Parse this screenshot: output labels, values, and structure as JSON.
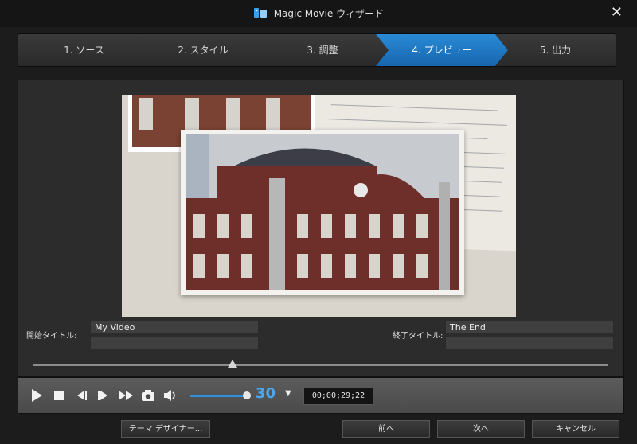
{
  "window": {
    "title": "Magic Movie ウィザード",
    "close_icon": "close-icon"
  },
  "steps": [
    {
      "label": "1. ソース",
      "active": false
    },
    {
      "label": "2. スタイル",
      "active": false
    },
    {
      "label": "3. 調整",
      "active": false
    },
    {
      "label": "4. プレビュー",
      "active": true
    },
    {
      "label": "5. 出力",
      "active": false
    }
  ],
  "titles": {
    "start_label": "開始タイトル:",
    "start_value": "My Video",
    "end_label": "終了タイトル:",
    "end_value": "The End"
  },
  "player": {
    "fps": "30",
    "timecode": "00;00;29;22",
    "icons": [
      "play-icon",
      "stop-icon",
      "prev-frame-icon",
      "next-frame-icon",
      "fast-forward-icon",
      "camera-icon",
      "volume-icon"
    ]
  },
  "buttons": {
    "theme_designer": "テーマ デザイナー...",
    "back": "前へ",
    "next": "次へ",
    "cancel": "キャンセル"
  },
  "colors": {
    "accent": "#2a8ad6",
    "background": "#1c1c1c"
  }
}
